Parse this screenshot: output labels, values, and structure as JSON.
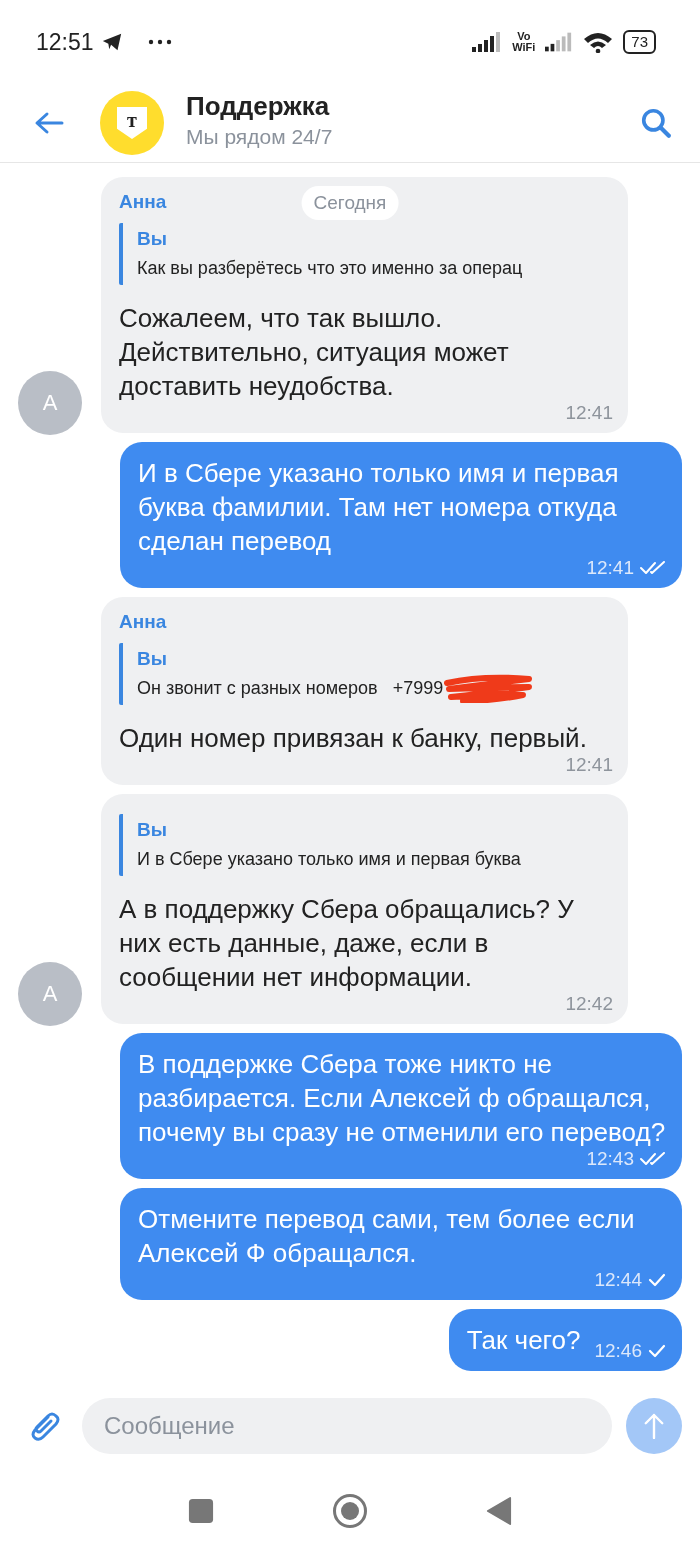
{
  "status_bar": {
    "time": "12:51",
    "vowifi_top": "Vo",
    "vowifi_bottom": "WiFi",
    "battery": "73"
  },
  "header": {
    "logo_letter": "т",
    "title": "Поддержка",
    "subtitle": "Мы рядом 24/7"
  },
  "date_chip": "Сегодня",
  "messages": [
    {
      "kind": "incoming",
      "sender": "Анна",
      "avatar": "А",
      "quote": {
        "author": "Вы",
        "text": "Как вы разберётесь что это именно за операц"
      },
      "text": "Сожалеем, что так вышло. Действительно, ситуация может доставить неудобства.",
      "time": "12:41"
    },
    {
      "kind": "outgoing",
      "text": "И в Сбере указано только имя и первая буква фамилии. Там нет номера откуда сделан перевод",
      "time": "12:41",
      "read": true
    },
    {
      "kind": "incoming",
      "sender": "Анна",
      "quote": {
        "author": "Вы",
        "text": "Он звонит с разных номеров   +7999",
        "redacted": true
      },
      "text": "Один номер привязан к банку, первый.",
      "time": "12:41"
    },
    {
      "kind": "incoming",
      "quote": {
        "author": "Вы",
        "text": "И в Сбере указано только имя и первая буква"
      },
      "avatar": "А",
      "text": "А в поддержку Сбера обращались? У них есть данные, даже, если в сообщении нет информации.",
      "time": "12:42"
    },
    {
      "kind": "outgoing",
      "text": "В поддержке Сбера тоже никто не разбирается. Если Алексей ф обращался, почему вы сразу не отменили его перевод?",
      "time": "12:43",
      "read": true
    },
    {
      "kind": "outgoing",
      "text": "Отмените перевод сами, тем более если Алексей Ф обращался.",
      "time": "12:44",
      "read": false
    },
    {
      "kind": "outgoing",
      "text": "Так чего?",
      "time": "12:46",
      "read": false
    }
  ],
  "composer": {
    "placeholder": "Сообщение",
    "send_disabled": true
  }
}
